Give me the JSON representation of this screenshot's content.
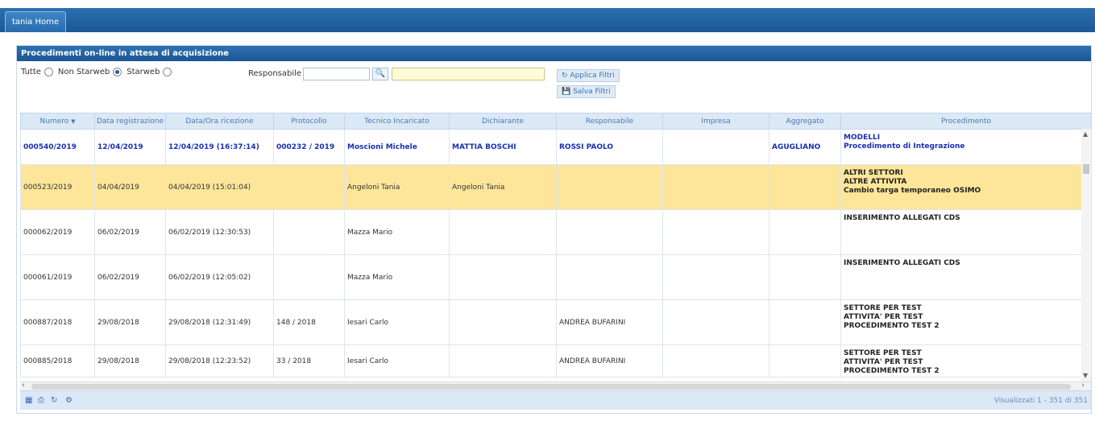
{
  "window": {
    "tab": "tania Home"
  },
  "panel": {
    "title": "Procedimenti on-line in attesa di acquisizione"
  },
  "filters": {
    "radio_all": "Tutte",
    "radio_non_starweb": "Non Starweb",
    "radio_starweb": "Starweb",
    "selected": "Starweb",
    "responsabile_label": "Responsabile",
    "apply_label": "Applica Filtri",
    "save_label": "Salva Filtri"
  },
  "table": {
    "columns": [
      "Numero",
      "Data registrazione",
      "Data/Ora ricezione",
      "Protocollo",
      "Tecnico Incaricato",
      "Dichiarante",
      "Responsabile",
      "Impresa",
      "Aggregato",
      "Procedimento"
    ],
    "rows": [
      {
        "numero": "000540/2019",
        "data_reg": "12/04/2019",
        "data_ric": "12/04/2019 (16:37:14)",
        "protocollo": "000232 / 2019",
        "tecnico": "Moscioni Michele",
        "dichiarante": "MATTIA BOSCHI",
        "responsabile": "ROSSI PAOLO",
        "impresa": "",
        "aggregato": "AGUGLIANO",
        "proc1": "MODELLI",
        "proc2": "Procedimento di Integrazione",
        "proc3": ""
      },
      {
        "numero": "000523/2019",
        "data_reg": "04/04/2019",
        "data_ric": "04/04/2019 (15:01:04)",
        "protocollo": "",
        "tecnico": "Angeloni Tania",
        "dichiarante": "Angeloni Tania",
        "responsabile": "",
        "impresa": "",
        "aggregato": "",
        "proc1": "ALTRI SETTORI",
        "proc2": "ALTRE ATTIVITA",
        "proc3": "Cambio targa temporaneo OSIMO"
      },
      {
        "numero": "000062/2019",
        "data_reg": "06/02/2019",
        "data_ric": "06/02/2019 (12:30:53)",
        "protocollo": "",
        "tecnico": "Mazza Mario",
        "dichiarante": "",
        "responsabile": "",
        "impresa": "",
        "aggregato": "",
        "proc1": "INSERIMENTO ALLEGATI CDS",
        "proc2": "",
        "proc3": ""
      },
      {
        "numero": "000061/2019",
        "data_reg": "06/02/2019",
        "data_ric": "06/02/2019 (12:05:02)",
        "protocollo": "",
        "tecnico": "Mazza Mario",
        "dichiarante": "",
        "responsabile": "",
        "impresa": "",
        "aggregato": "",
        "proc1": "INSERIMENTO ALLEGATI CDS",
        "proc2": "",
        "proc3": ""
      },
      {
        "numero": "000887/2018",
        "data_reg": "29/08/2018",
        "data_ric": "29/08/2018 (12:31:49)",
        "protocollo": "148 / 2018",
        "tecnico": "Iesari Carlo",
        "dichiarante": "",
        "responsabile": "ANDREA BUFARINI",
        "impresa": "",
        "aggregato": "",
        "proc1": "SETTORE PER TEST",
        "proc2": "ATTIVITA' PER TEST",
        "proc3": "PROCEDIMENTO TEST 2"
      },
      {
        "numero": "000885/2018",
        "data_reg": "29/08/2018",
        "data_ric": "29/08/2018 (12:23:52)",
        "protocollo": "33 / 2018",
        "tecnico": "Iesari Carlo",
        "dichiarante": "",
        "responsabile": "ANDREA BUFARINI",
        "impresa": "",
        "aggregato": "",
        "proc1": "SETTORE PER TEST",
        "proc2": "ATTIVITA' PER TEST",
        "proc3": "PROCEDIMENTO TEST 2"
      }
    ]
  },
  "footer": {
    "count": "Visualizzati 1 - 351 di 351"
  },
  "icons": {
    "search": "search-icon",
    "apply": "refresh-icon",
    "save": "save-icon",
    "export": "export-icon",
    "print": "print-icon",
    "reload": "reload-icon",
    "settings": "gear-icon"
  },
  "colors": {
    "header_blue": "#1c5796",
    "highlight_row": "#fde69a",
    "bold_row": "#1a2fb0"
  }
}
